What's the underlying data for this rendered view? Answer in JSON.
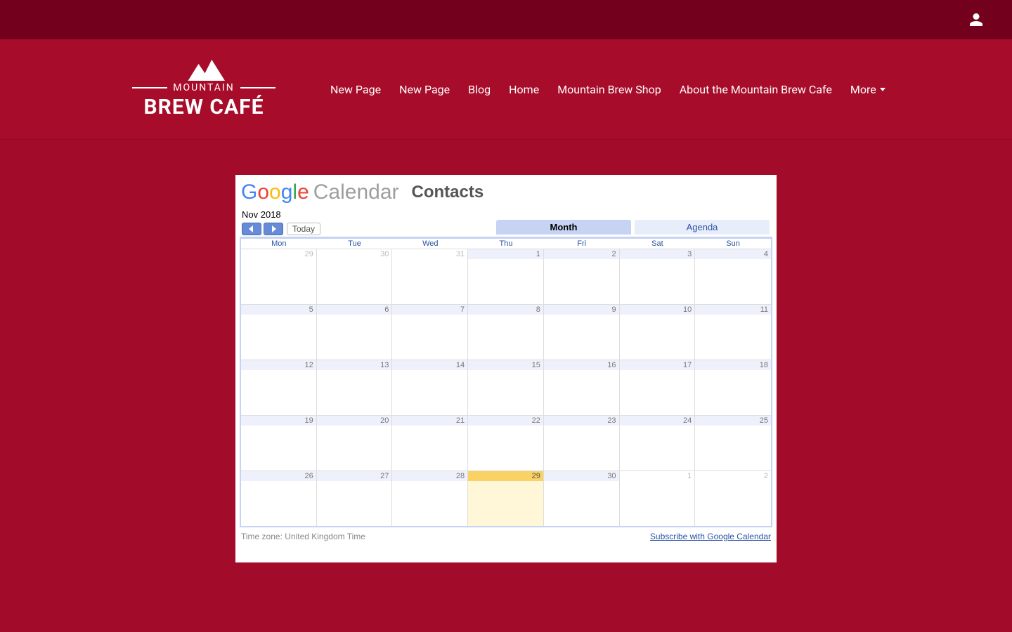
{
  "logo": {
    "small": "MOUNTAIN",
    "big": "BREW CAFÉ"
  },
  "nav": {
    "items": [
      "New Page",
      "New Page",
      "Blog",
      "Home",
      "Mountain Brew Shop",
      "About the Mountain Brew Cafe"
    ],
    "more": "More"
  },
  "calendar": {
    "brand_word": "Calendar",
    "contacts": "Contacts",
    "title": "Nov 2018",
    "today_btn": "Today",
    "view_month": "Month",
    "view_agenda": "Agenda",
    "dow": [
      "Mon",
      "Tue",
      "Wed",
      "Thu",
      "Fri",
      "Sat",
      "Sun"
    ],
    "weeks": [
      [
        {
          "n": "29",
          "other": true
        },
        {
          "n": "30",
          "other": true
        },
        {
          "n": "31",
          "other": true
        },
        {
          "n": "1"
        },
        {
          "n": "2"
        },
        {
          "n": "3"
        },
        {
          "n": "4"
        }
      ],
      [
        {
          "n": "5"
        },
        {
          "n": "6"
        },
        {
          "n": "7"
        },
        {
          "n": "8"
        },
        {
          "n": "9"
        },
        {
          "n": "10"
        },
        {
          "n": "11"
        }
      ],
      [
        {
          "n": "12"
        },
        {
          "n": "13"
        },
        {
          "n": "14"
        },
        {
          "n": "15"
        },
        {
          "n": "16"
        },
        {
          "n": "17"
        },
        {
          "n": "18"
        }
      ],
      [
        {
          "n": "19"
        },
        {
          "n": "20"
        },
        {
          "n": "21"
        },
        {
          "n": "22"
        },
        {
          "n": "23"
        },
        {
          "n": "24"
        },
        {
          "n": "25"
        }
      ],
      [
        {
          "n": "26"
        },
        {
          "n": "27"
        },
        {
          "n": "28"
        },
        {
          "n": "29",
          "today": true
        },
        {
          "n": "30"
        },
        {
          "n": "1",
          "other": true
        },
        {
          "n": "2",
          "other": true
        }
      ]
    ],
    "tz": "Time zone: United Kingdom Time",
    "subscribe": "Subscribe with Google Calendar"
  }
}
